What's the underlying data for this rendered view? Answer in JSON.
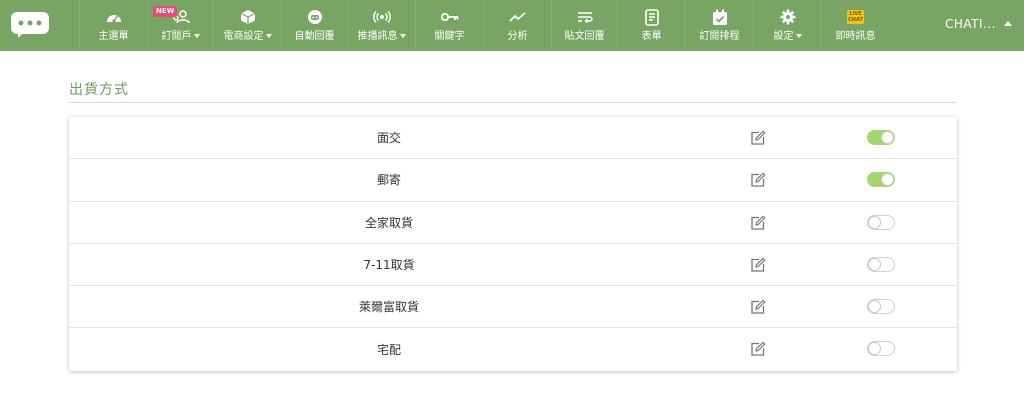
{
  "header": {
    "nav": [
      {
        "label": "主選單",
        "icon": "dashboard-icon",
        "caret": false
      },
      {
        "label": "訂閱戶",
        "icon": "subscribers-icon",
        "caret": true,
        "badge": "NEW"
      },
      {
        "label": "電商設定",
        "icon": "package-icon",
        "caret": true
      },
      {
        "label": "自動回覆",
        "icon": "robot-icon",
        "caret": false
      },
      {
        "label": "推播訊息",
        "icon": "broadcast-icon",
        "caret": true
      },
      {
        "label": "關鍵字",
        "icon": "key-icon",
        "caret": false
      },
      {
        "label": "分析",
        "icon": "chart-line-icon",
        "caret": false
      },
      {
        "label": "貼文回覆",
        "icon": "reply-icon",
        "caret": false
      },
      {
        "label": "表單",
        "icon": "form-icon",
        "caret": false
      },
      {
        "label": "訂閱排程",
        "icon": "calendar-check-icon",
        "caret": false
      },
      {
        "label": "設定",
        "icon": "gear-icon",
        "caret": true
      },
      {
        "label": "即時訊息",
        "icon": "live-chat-icon",
        "caret": false
      }
    ],
    "new_badge": "NEW",
    "live_badge_top": "LIVE",
    "live_badge_bottom": "CHAT",
    "user": "CHATI..."
  },
  "section": {
    "title": "出貨方式"
  },
  "shipping_methods": [
    {
      "name": "面交",
      "enabled": true
    },
    {
      "name": "郵寄",
      "enabled": true
    },
    {
      "name": "全家取貨",
      "enabled": false
    },
    {
      "name": "7-11取貨",
      "enabled": false
    },
    {
      "name": "萊爾富取貨",
      "enabled": false
    },
    {
      "name": "宅配",
      "enabled": false
    }
  ],
  "colors": {
    "header": "#78a563",
    "accent": "#6e9a59",
    "toggle_on": "#a4d86e"
  }
}
